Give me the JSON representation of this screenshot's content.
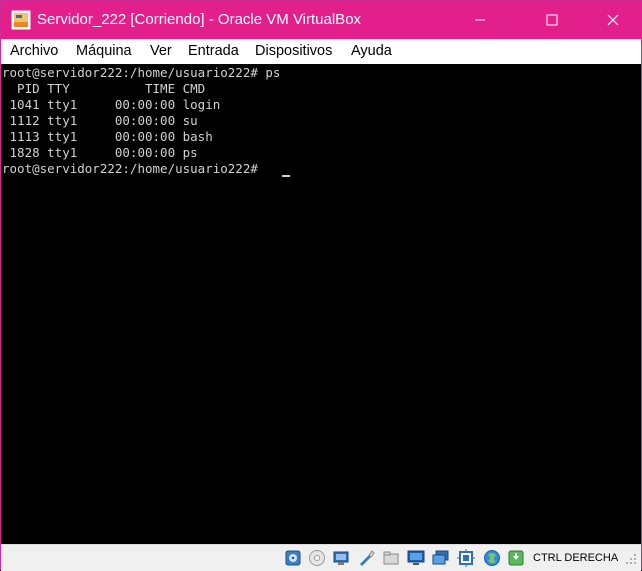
{
  "window": {
    "title": "Servidor_222 [Corriendo] - Oracle VM VirtualBox"
  },
  "menu": {
    "items": [
      "Archivo",
      "Máquina",
      "Ver",
      "Entrada",
      "Dispositivos",
      "Ayuda"
    ]
  },
  "console": {
    "lines": [
      "root@servidor222:/home/usuario222# ps",
      "  PID TTY          TIME CMD",
      " 1041 tty1     00:00:00 login",
      " 1112 tty1     00:00:00 su",
      " 1113 tty1     00:00:00 bash",
      " 1828 tty1     00:00:00 ps",
      "root@servidor222:/home/usuario222# "
    ]
  },
  "statusbar": {
    "host_key": "CTRL DERECHA"
  },
  "colors": {
    "titlebar": "#e31f8c",
    "console_bg": "#000000",
    "console_text": "#d2d2d2",
    "statusbar": "#f0f0f0"
  },
  "icons": [
    "virtualbox-app-icon",
    "minimize-icon",
    "maximize-icon",
    "close-icon",
    "hard-disk-icon",
    "optical-drive-icon",
    "audio-icon",
    "network-icon",
    "usb-icon",
    "shared-folders-icon",
    "display-icon",
    "video-capture-icon",
    "cpu-icon",
    "mouse-integration-icon",
    "host-key-arrow-icon"
  ]
}
